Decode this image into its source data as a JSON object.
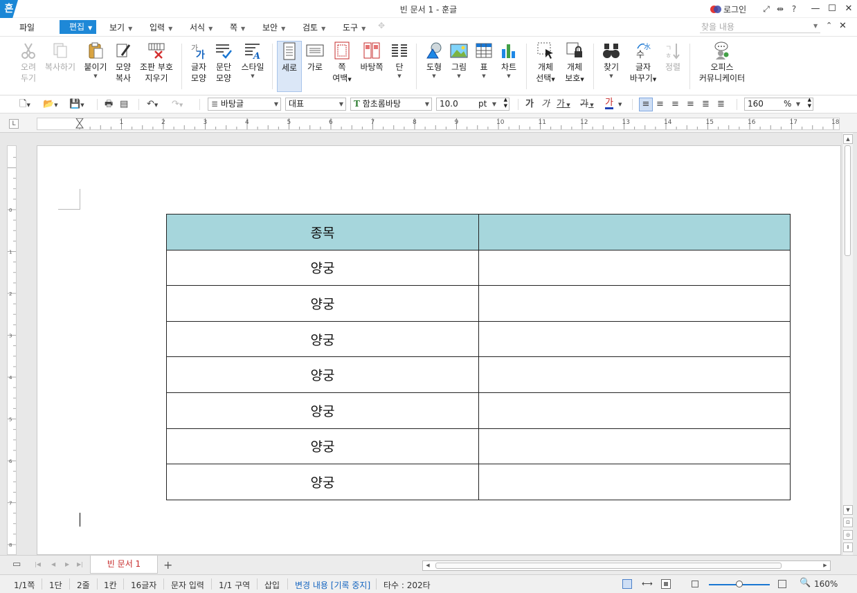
{
  "title_bar": {
    "logo": "흔",
    "title": "빈 문서 1 - 훈글",
    "login": "로그인",
    "icons": [
      "fullscreen-icon",
      "split-icon",
      "help-icon"
    ],
    "help": "?",
    "window_controls": [
      "minimize-icon",
      "maximize-icon",
      "close-icon"
    ]
  },
  "menu": {
    "items": [
      "파일",
      "편집",
      "보기",
      "입력",
      "서식",
      "쪽",
      "보안",
      "검토",
      "도구"
    ],
    "active": "편집",
    "search_placeholder": "찾을 내용"
  },
  "ribbon": {
    "buttons": [
      {
        "label1": "오려",
        "label2": "두기",
        "icon": "scissors-icon",
        "disabled": true
      },
      {
        "label1": "복사하기",
        "label2": "",
        "icon": "copy-icon",
        "disabled": true
      },
      {
        "label1": "붙이기",
        "label2": "",
        "icon": "paste-icon",
        "disabled": false
      },
      {
        "label1": "모양",
        "label2": "복사",
        "icon": "format-painter-icon",
        "disabled": false
      },
      {
        "label1": "조판 부호",
        "label2": "지우기",
        "icon": "clear-codes-icon",
        "disabled": false
      },
      {
        "label1": "글자",
        "label2": "모양",
        "icon": "char-shape-icon",
        "disabled": false
      },
      {
        "label1": "문단",
        "label2": "모양",
        "icon": "para-shape-icon",
        "disabled": false
      },
      {
        "label1": "스타일",
        "label2": "",
        "icon": "style-icon",
        "disabled": false
      },
      {
        "label1": "세로",
        "label2": "",
        "icon": "portrait-icon",
        "disabled": false
      },
      {
        "label1": "가로",
        "label2": "",
        "icon": "landscape-icon",
        "disabled": false
      },
      {
        "label1": "쪽",
        "label2": "여백",
        "icon": "margin-icon",
        "disabled": false
      },
      {
        "label1": "바탕쪽",
        "label2": "",
        "icon": "master-page-icon",
        "disabled": false
      },
      {
        "label1": "단",
        "label2": "",
        "icon": "columns-icon",
        "disabled": false
      },
      {
        "label1": "도형",
        "label2": "",
        "icon": "shape-icon",
        "disabled": false
      },
      {
        "label1": "그림",
        "label2": "",
        "icon": "picture-icon",
        "disabled": false
      },
      {
        "label1": "표",
        "label2": "",
        "icon": "table-icon",
        "disabled": false
      },
      {
        "label1": "차트",
        "label2": "",
        "icon": "chart-icon",
        "disabled": false
      },
      {
        "label1": "개체",
        "label2": "선택",
        "icon": "select-object-icon",
        "disabled": false
      },
      {
        "label1": "개체",
        "label2": "보호",
        "icon": "protect-object-icon",
        "disabled": false
      },
      {
        "label1": "찾기",
        "label2": "",
        "icon": "binoculars-icon",
        "disabled": false
      },
      {
        "label1": "글자",
        "label2": "바꾸기",
        "icon": "replace-char-icon",
        "disabled": false
      },
      {
        "label1": "정렬",
        "label2": "",
        "icon": "sort-icon",
        "disabled": true
      },
      {
        "label1": "오피스",
        "label2": "커뮤니케이터",
        "icon": "communicator-icon",
        "disabled": false
      }
    ]
  },
  "toolbar": {
    "style": "바탕글",
    "lang": "대표",
    "font": "함초롬바탕",
    "font_badge": "T",
    "size": "10.0",
    "unit": "pt",
    "bold": "가",
    "italic": "가",
    "underline": "가",
    "strike": "가",
    "color": "가",
    "zoom": "160",
    "zoom_unit": "%"
  },
  "ruler": {
    "corner": "L",
    "h_ticks": [
      "1",
      "2",
      "3",
      "4",
      "5",
      "6",
      "7",
      "8",
      "9",
      "10",
      "11",
      "12",
      "13",
      "14",
      "15",
      "16",
      "17",
      "18"
    ],
    "v_ticks": [
      "0",
      "1",
      "2",
      "3",
      "4",
      "5",
      "6",
      "7",
      "8"
    ]
  },
  "table": {
    "header": [
      "종목",
      ""
    ],
    "rows": [
      [
        "양궁",
        ""
      ],
      [
        "양궁",
        ""
      ],
      [
        "양궁",
        ""
      ],
      [
        "양궁",
        ""
      ],
      [
        "양궁",
        ""
      ],
      [
        "양궁",
        ""
      ],
      [
        "양궁",
        ""
      ]
    ],
    "header_color": "#a6d6dc"
  },
  "tabs": {
    "doc_tab": "빈 문서 1",
    "add": "+"
  },
  "status": {
    "page": "1/1쪽",
    "column": "1단",
    "line": "2줄",
    "cell": "1칸",
    "chars": "16글자",
    "mode": "문자 입력",
    "section": "1/1 구역",
    "insert": "삽입",
    "track": "변경 내용 [기록 중지]",
    "typing": "타수 : 202타",
    "zoom": "160%",
    "zoom_level": 0.5
  }
}
